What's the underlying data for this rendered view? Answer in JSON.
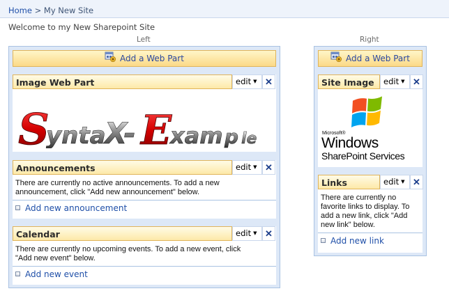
{
  "breadcrumb": {
    "home": "Home",
    "separator": ">",
    "current": "My New Site"
  },
  "welcome": "Welcome to my New Sharepoint Site",
  "zones": {
    "left": {
      "label": "Left",
      "add_web_part": "Add a Web Part",
      "parts": {
        "image": {
          "title": "Image Web Part",
          "edit": "edit",
          "close": "✕",
          "logo_text": "SyntaX-Example"
        },
        "announcements": {
          "title": "Announcements",
          "edit": "edit",
          "close": "✕",
          "body": "There are currently no active announcements. To add a new announcement, click \"Add new announcement\" below.",
          "add_link": "Add new announcement"
        },
        "calendar": {
          "title": "Calendar",
          "edit": "edit",
          "close": "✕",
          "body": "There are currently no upcoming events. To add a new event, click \"Add new event\" below.",
          "add_link": "Add new event"
        }
      }
    },
    "right": {
      "label": "Right",
      "add_web_part": "Add a Web Part",
      "parts": {
        "site_image": {
          "title": "Site Image",
          "edit": "edit",
          "close": "✕",
          "logo_text": "Microsoft Windows SharePoint Services"
        },
        "links": {
          "title": "Links",
          "edit": "edit",
          "close": "✕",
          "body": "There are currently no favorite links to display. To add a new link, click \"Add new link\" below.",
          "add_link": "Add new link"
        }
      }
    }
  },
  "colors": {
    "zone_bg": "#dde8f7",
    "zone_border": "#a9c2e2",
    "header_gradient_end": "#fde9a8",
    "link": "#1f4fa8"
  },
  "icons": {
    "add_web_part": "add-web-part-icon",
    "close": "close-icon",
    "dropdown": "chevron-down-icon",
    "bullet": "square-bullet-icon"
  }
}
